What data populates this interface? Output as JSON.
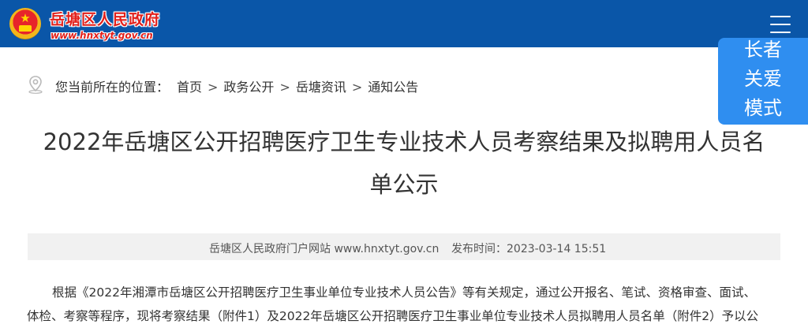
{
  "header": {
    "site_name": "岳塘区人民政府",
    "site_url": "www.hnxtyt.gov.cn",
    "logo_icon": "national-emblem-icon",
    "menu_icon": "hamburger-menu-icon",
    "bar_color": "#0a56a8",
    "name_color": "#e2201b"
  },
  "elder_mode": {
    "line1": "长者",
    "line2": "关爱",
    "line3": "模式",
    "color": "#2f8ef0"
  },
  "breadcrumb": {
    "icon": "location-pin-icon",
    "label": "您当前所在的位置：",
    "items": [
      "首页",
      "政务公开",
      "岳塘资讯",
      "通知公告"
    ],
    "separator": ">"
  },
  "article": {
    "title_line1": "2022年岳塘区公开招聘医疗卫生专业技术人员考察结果及拟聘用人员名",
    "title_line2": "单公示",
    "source": "岳塘区人民政府门户网站 www.hnxtyt.gov.cn",
    "publish_time": "发布时间：2023-03-14 15:51",
    "paragraph_line1": "根据《2022年湘潭市岳塘区公开招聘医疗卫生事业单位专业技术人员公告》等有关规定，通过公开报名、笔试、资格审查、面试、",
    "paragraph_line2": "体检、考察等程序，现将考察结果（附件1）及2022年岳塘区公开招聘医疗卫生事业单位专业技术人员拟聘用人员名单（附件2）予以公"
  }
}
